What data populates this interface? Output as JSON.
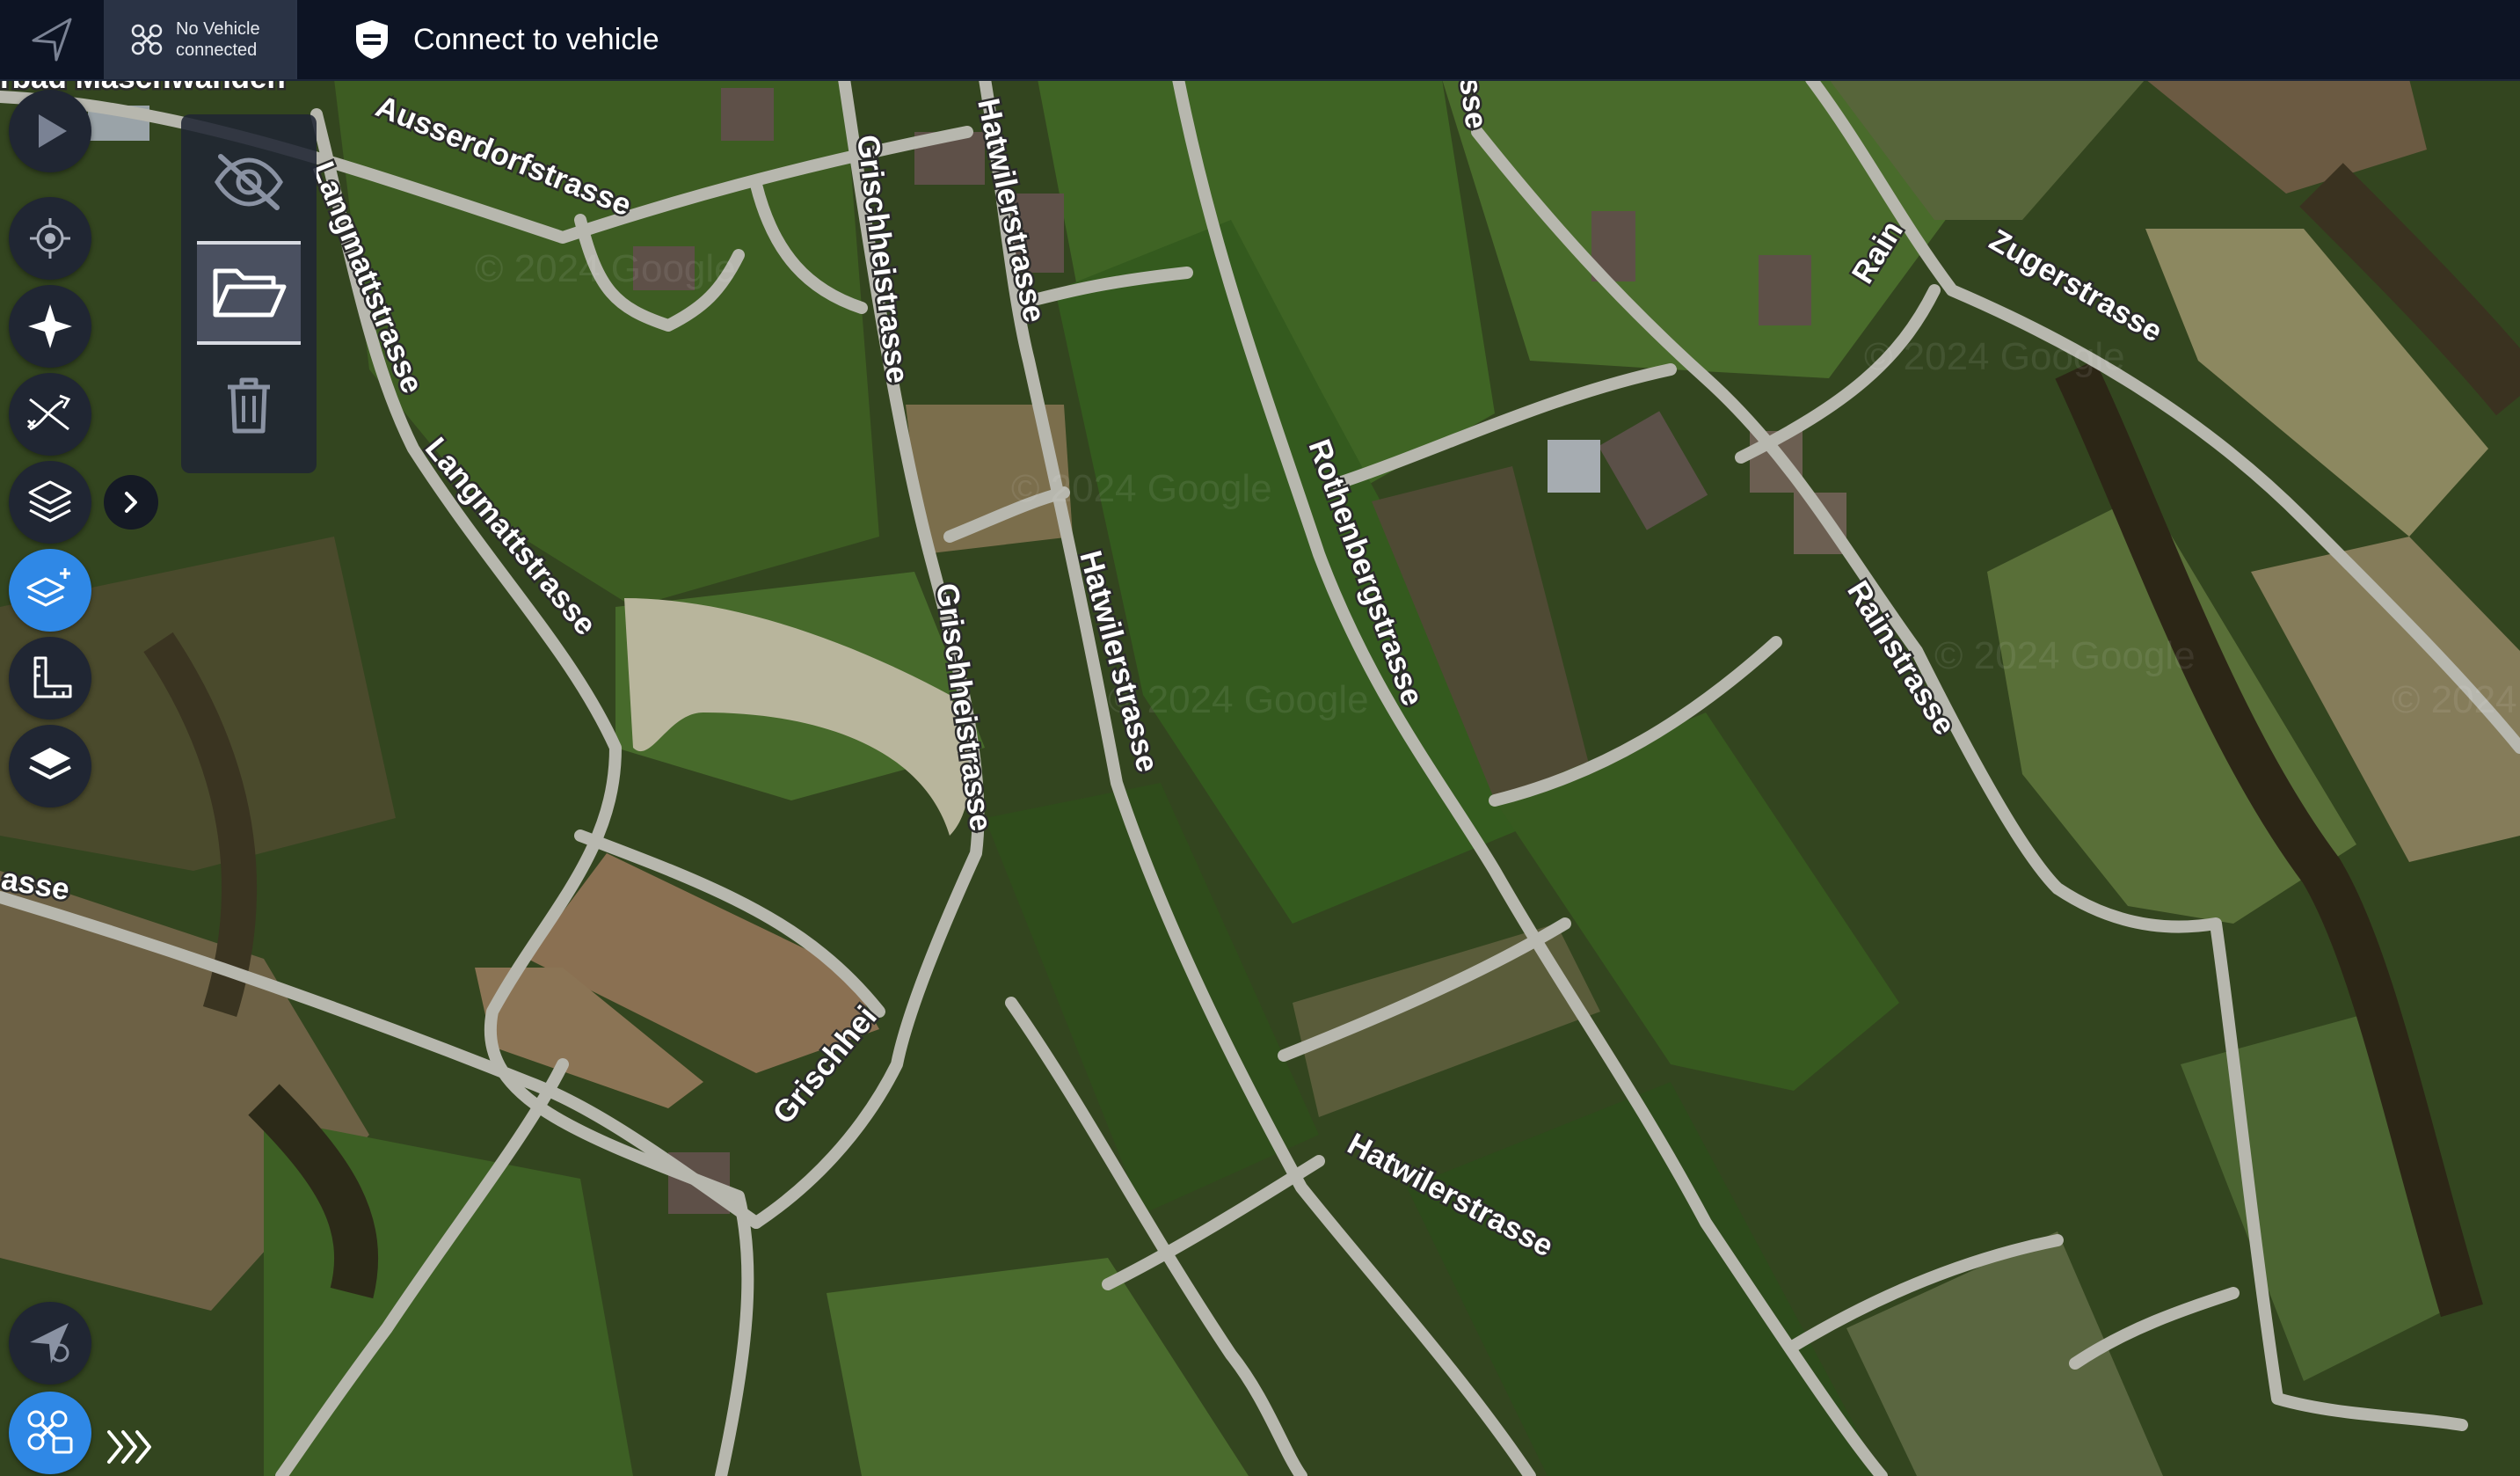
{
  "topbar": {
    "vehicle_status_line1": "No Vehicle",
    "vehicle_status_line2": "connected",
    "connect_label": "Connect to vehicle"
  },
  "toolbar": {
    "icons": [
      "play-icon",
      "crosshair-icon",
      "compass-star-icon",
      "shuffle-path-icon",
      "layers-icon",
      "layers-add-icon",
      "ruler-measure-icon",
      "layers-filled-icon",
      "plane-target-icon",
      "drone-settings-icon"
    ],
    "active_accent": "#2f88e6"
  },
  "panel": {
    "icons": [
      "eye-off-icon",
      "folder-open-icon",
      "trash-icon"
    ]
  },
  "map": {
    "watermark": "© 2024 Google",
    "road_labels": {
      "maschwanden": "rbad Maschwanden",
      "ausserdorf": "Ausserdorfstrasse",
      "langmatt1": "Langmattstrasse",
      "langmatt2": "Langmattstrasse",
      "grischhei1": "Grischheistrasse",
      "grischhei2": "Grischheistrasse",
      "grischhei3": "Grischhei",
      "hatwiler1": "Hatwilerstrasse",
      "hatwiler2": "Hatwilerstrasse",
      "hatwiler3": "Hatwilerstrasse",
      "rothenberg": "Rothenbergstrasse",
      "rain": "Rain",
      "rainstrasse": "Rainstrasse",
      "zuger": "Zugerstrasse",
      "sse": "sse",
      "asse": "asse"
    }
  }
}
